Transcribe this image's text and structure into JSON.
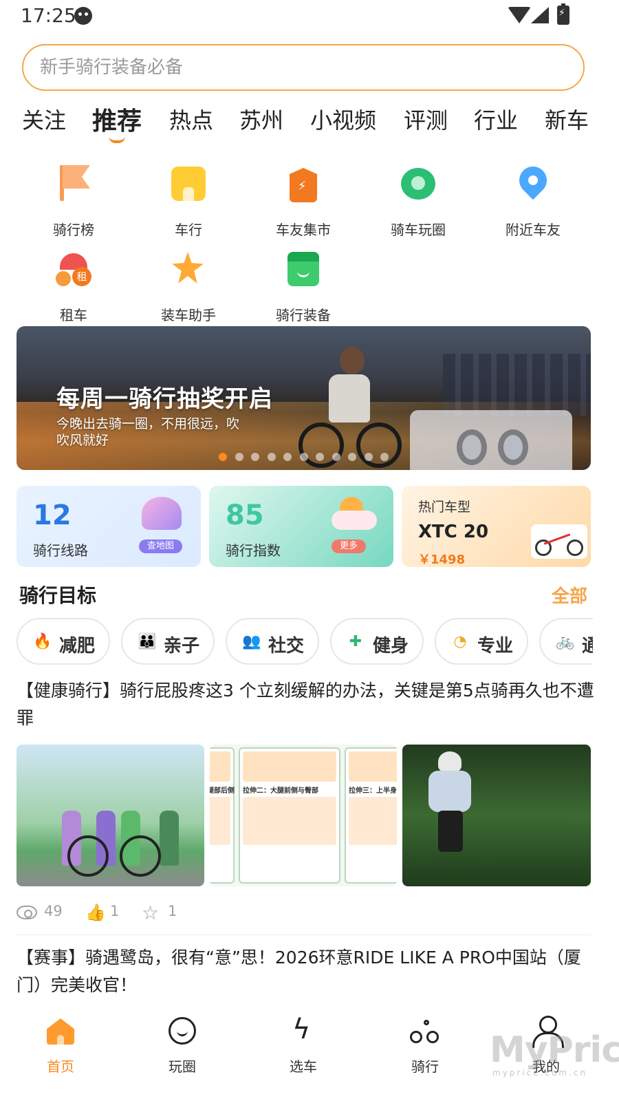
{
  "status_bar": {
    "time": "17:25"
  },
  "search": {
    "placeholder": "新手骑行装备必备"
  },
  "tabs": [
    {
      "label": "关注"
    },
    {
      "label": "推荐",
      "active": true
    },
    {
      "label": "热点"
    },
    {
      "label": "苏州"
    },
    {
      "label": "小视频"
    },
    {
      "label": "评测"
    },
    {
      "label": "行业"
    },
    {
      "label": "新车"
    }
  ],
  "quick_grid": [
    {
      "label": "骑行榜",
      "icon": "flag-icon"
    },
    {
      "label": "车行",
      "icon": "shop-icon"
    },
    {
      "label": "车友集市",
      "icon": "tag-icon"
    },
    {
      "label": "骑车玩圈",
      "icon": "chat-icon"
    },
    {
      "label": "附近车友",
      "icon": "location-pin-icon"
    },
    {
      "label": "租车",
      "icon": "bike-rental-icon",
      "badge": "租"
    },
    {
      "label": "装车助手",
      "icon": "star-icon"
    },
    {
      "label": "骑行装备",
      "icon": "store-icon"
    }
  ],
  "banner": {
    "title": "每周一骑行抽奖开启",
    "subtitle": "今晚出去骑一圈，不用很远，吹吹风就好",
    "dot_count": 11,
    "active_dot": 0
  },
  "cards": {
    "routes": {
      "value": "12",
      "label": "骑行线路",
      "action": "查地图"
    },
    "index": {
      "value": "85",
      "label": "骑行指数",
      "action": "更多"
    },
    "hot_model": {
      "title": "热门车型",
      "model": "XTC 20",
      "price": "￥1498"
    }
  },
  "goals": {
    "title": "骑行目标",
    "more": "全部",
    "chips": [
      {
        "label": "减肥",
        "icon": "flame-icon",
        "color": "#f25a3a"
      },
      {
        "label": "亲子",
        "icon": "family-icon",
        "color": "#2d8cf0"
      },
      {
        "label": "社交",
        "icon": "group-icon",
        "color": "#8a6cf0"
      },
      {
        "label": "健身",
        "icon": "dumbbell-icon",
        "color": "#2bb673"
      },
      {
        "label": "专业",
        "icon": "gauge-icon",
        "color": "#f5a623"
      },
      {
        "label": "通",
        "icon": "bicycle-icon",
        "color": "#2d8cf0"
      }
    ]
  },
  "articles": [
    {
      "title": "【健康骑行】骑行屁股疼这3 个立刻缓解的办法，关键是第5点骑再久也不遭罪",
      "panels": [
        "拉伸一：腿部后侧",
        "拉伸二：大腿前侧与臀部",
        "拉伸三：上半身"
      ],
      "views": "49",
      "likes": "1",
      "favorites": "1"
    },
    {
      "title": "【赛事】骑遇鹭岛，很有“意”思！2026环意RIDE LIKE A PRO中国站（厦门）完美收官！"
    }
  ],
  "bottom_nav": [
    {
      "label": "首页",
      "icon": "home-icon",
      "active": true
    },
    {
      "label": "玩圈",
      "icon": "smile-icon"
    },
    {
      "label": "选车",
      "icon": "lightning-icon"
    },
    {
      "label": "骑行",
      "icon": "bicycle-icon"
    },
    {
      "label": "我的",
      "icon": "user-icon"
    }
  ],
  "watermark": {
    "text": "MyPrice",
    "sub": "myprice.com.cn"
  },
  "colors": {
    "accent": "#f58a1f",
    "search_border": "#f5a64a"
  }
}
